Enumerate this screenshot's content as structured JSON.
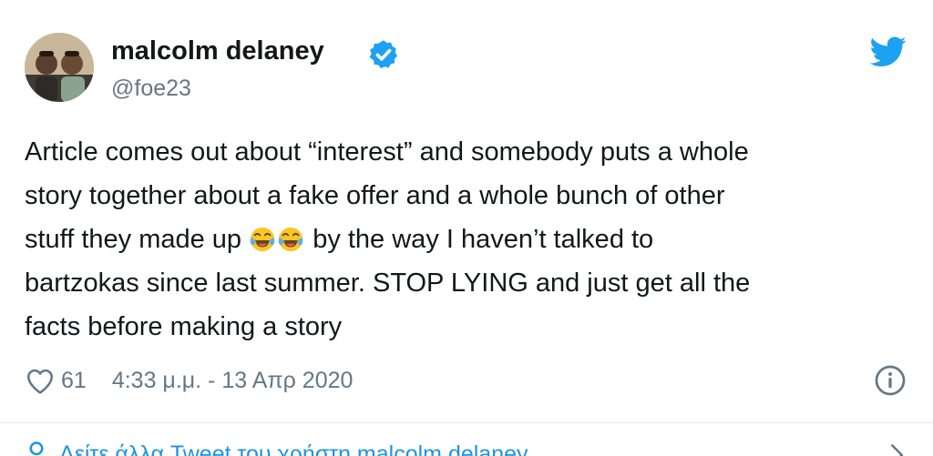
{
  "author": {
    "name": "malcolm delaney",
    "handle": "@foe23",
    "verified": true
  },
  "tweet": {
    "line1": "Article comes out about “interest” and somebody puts a whole",
    "line2": "story together about a fake offer and a whole bunch of other",
    "line3_before_emoji": "stuff they made up",
    "emojis": [
      "face-with-tears-of-joy-icon",
      "face-with-tears-of-joy-icon"
    ],
    "line3_after_emoji": "by the way I haven’t talked to",
    "line4": "bartzokas since last summer. STOP LYING and just get all the",
    "line5": "facts before making a story"
  },
  "meta": {
    "like_count": "61",
    "timestamp": "4:33 μ.μ. - 13 Απρ 2020"
  },
  "footer": {
    "link_text": "Δείτε άλλα Tweet του χρήστη malcolm delaney"
  },
  "colors": {
    "twitter_blue": "#1da1f2",
    "link_blue": "#1b95e0",
    "secondary_text": "#657786",
    "primary_text": "#14171a"
  },
  "icons": {
    "brand": "twitter-bird-icon",
    "verified": "verified-badge-icon",
    "like": "heart-icon",
    "info": "info-icon",
    "footer": "person-icon",
    "expand": "chevron-right-icon"
  }
}
